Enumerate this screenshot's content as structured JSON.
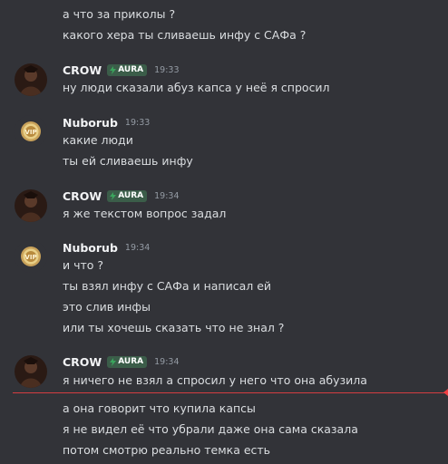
{
  "messages": {
    "m0": {
      "lines": [
        "а что за приколы ?",
        "какого хера ты сливаешь инфу с САФа ?"
      ]
    },
    "m1": {
      "author": "CROW",
      "badge": "AURA",
      "time": "19:33",
      "lines": [
        "ну люди сказали абуз капса у неё  я спросил"
      ]
    },
    "m2": {
      "author": "Nuborub",
      "time": "19:33",
      "lines": [
        "какие люди",
        "ты ей сливаешь инфу"
      ]
    },
    "m3": {
      "author": "CROW",
      "badge": "AURA",
      "time": "19:34",
      "lines": [
        "я же текстом вопрос задал"
      ]
    },
    "m4": {
      "author": "Nuborub",
      "time": "19:34",
      "lines": [
        "и что ?",
        "ты взял инфу с САФа и написал ей",
        "это слив инфы",
        "или ты хочешь сказать что не знал ?"
      ]
    },
    "m5": {
      "author": "CROW",
      "badge": "AURA",
      "time": "19:34",
      "lines": [
        "я ничего не взял а спросил у него что она абузила",
        "а она говорит что купила капсы",
        "я не видел её что убрали даже она сама сказала",
        "потом смотрю реально темка есть"
      ]
    }
  },
  "colors": {
    "background": "#323338",
    "text": "#dbdee1",
    "username": "#f2f3f5",
    "timestamp": "#949ba4",
    "badge_bg": "#3b5d49",
    "new_messages_divider": "#f23f43"
  },
  "icons": {
    "badge": "lightning-icon",
    "crow_avatar": "crow-avatar",
    "nuborub_avatar": "nuborub-avatar"
  }
}
